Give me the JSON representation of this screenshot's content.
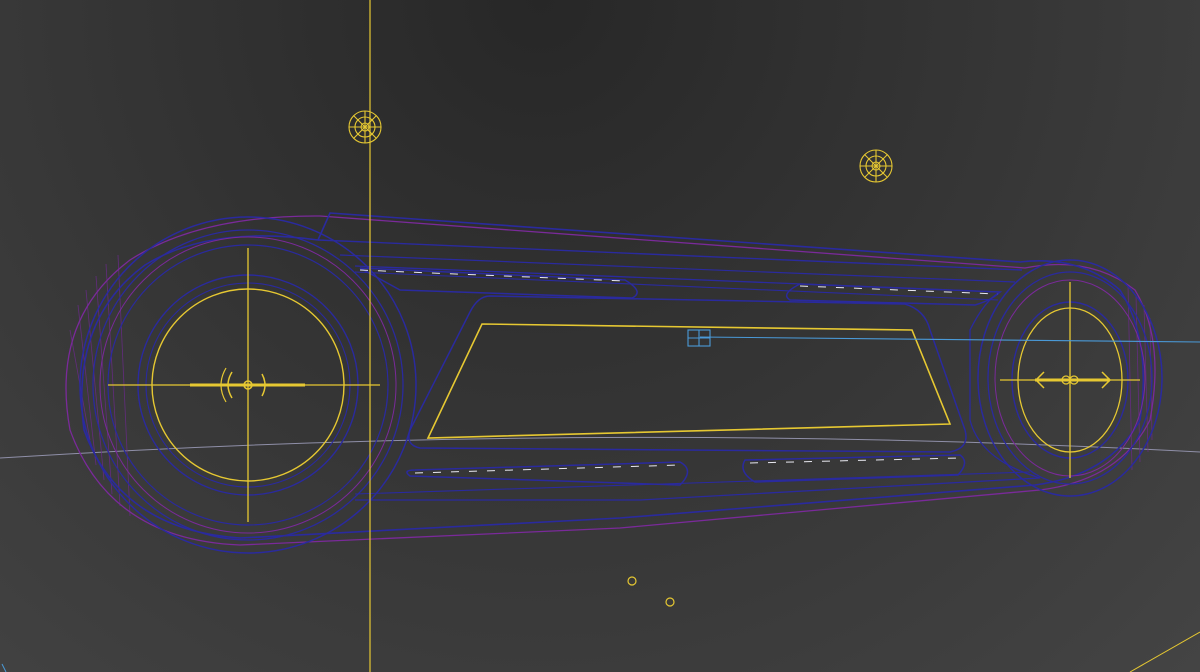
{
  "viewport": {
    "kind": "3d-wireframe-viewport",
    "background": "#3a3a3a",
    "colors": {
      "selection_yellow": "#e6c832",
      "outline_blue": "#2a2a9e",
      "outline_purple": "#7a2a9a",
      "hatch_purple": "#6a2a8a",
      "axis_cyan": "#4a9ad8",
      "horizon_grey": "#8f8fa8"
    },
    "objects": [
      {
        "name": "chain-guard-outline",
        "icon": "wireframe-spline"
      },
      {
        "name": "left-sprocket-gizmo",
        "icon": "transform-gizmo"
      },
      {
        "name": "right-sprocket-gizmo",
        "icon": "transform-gizmo"
      },
      {
        "name": "geosphere-helper-1",
        "icon": "geosphere-wireframe"
      },
      {
        "name": "geosphere-helper-2",
        "icon": "geosphere-wireframe"
      },
      {
        "name": "pivot-marker",
        "icon": "pivot-box"
      },
      {
        "name": "point-helpers",
        "icon": "point-helper"
      }
    ]
  }
}
